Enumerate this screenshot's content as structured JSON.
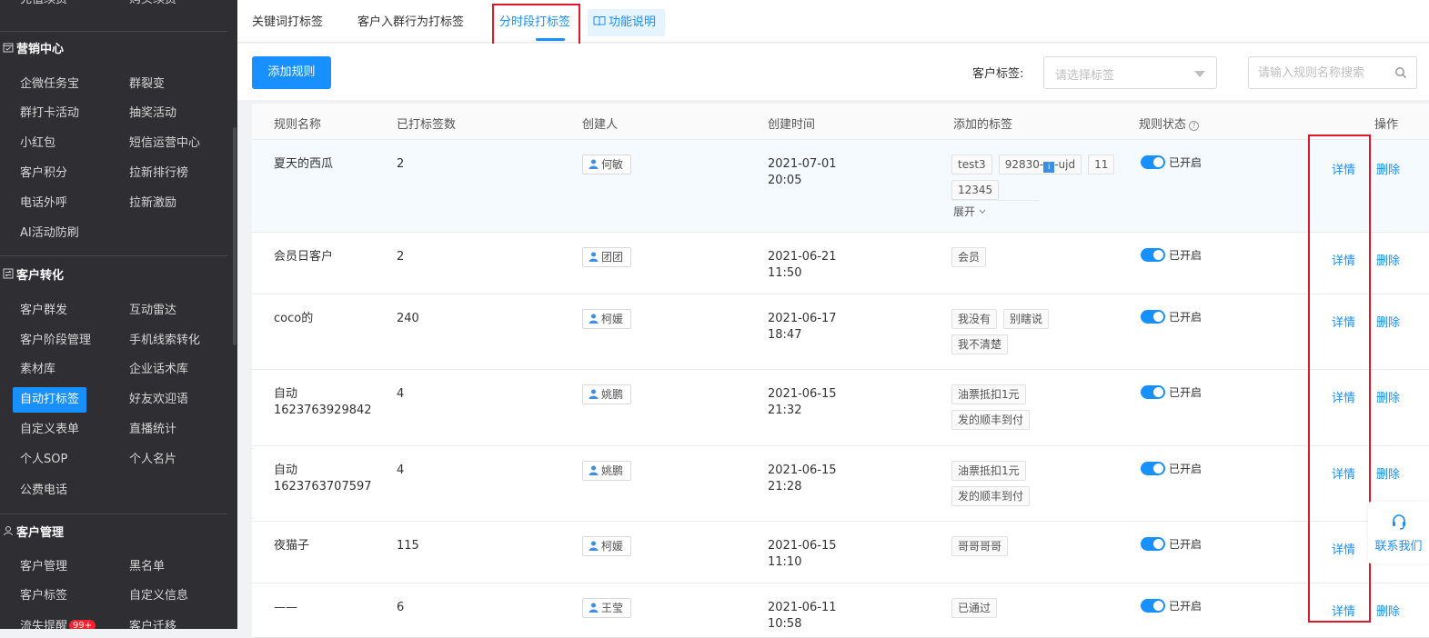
{
  "sidebar": {
    "top_cut_items": [
      "充值续费",
      "购买续费"
    ],
    "sections": [
      {
        "title": "营销中心",
        "icon": "calendar-check-icon",
        "items": [
          "企微任务宝",
          "群裂变",
          "群打卡活动",
          "抽奖活动",
          "小红包",
          "短信运营中心",
          "客户积分",
          "拉新排行榜",
          "电话外呼",
          "拉新激励",
          "AI活动防刷"
        ]
      },
      {
        "title": "客户转化",
        "icon": "swap-icon",
        "items": [
          "客户群发",
          "互动雷达",
          "客户阶段管理",
          "手机线索转化",
          "素材库",
          "企业话术库",
          "自动打标签",
          "好友欢迎语",
          "自定义表单",
          "直播统计",
          "个人SOP",
          "个人名片",
          "公费电话"
        ]
      },
      {
        "title": "客户管理",
        "icon": "user-icon",
        "items": [
          "客户管理",
          "黑名单",
          "客户标签",
          "自定义信息",
          "流失提醒",
          "客户迁移"
        ]
      }
    ],
    "active_item": "自动打标签",
    "loss_badge": "99+"
  },
  "tabs": {
    "keyword": "关键词打标签",
    "join_group": "客户入群行为打标签",
    "time_period": "分时段打标签",
    "help": "功能说明"
  },
  "toolbar": {
    "add_label": "添加规则",
    "filter_label": "客户标签:",
    "filter_placeholder": "请选择标签",
    "search_placeholder": "请输入规则名称搜索"
  },
  "table": {
    "headers": {
      "name": "规则名称",
      "count": "已打标签数",
      "creator": "创建人",
      "time": "创建时间",
      "tags": "添加的标签",
      "status": "规则状态",
      "ops": "操作"
    },
    "rows": [
      {
        "name": "夏天的西瓜",
        "count": "2",
        "creator": "何敏",
        "date": "2021-07-01",
        "clock": "20:05",
        "tags": [
          "test3",
          "92830-",
          "11",
          "12345"
        ],
        "expand": "展开",
        "status": "已开启"
      },
      {
        "name": "会员日客户",
        "count": "2",
        "creator": "团团",
        "date": "2021-06-21",
        "clock": "11:50",
        "tags": [
          "会员"
        ],
        "status": "已开启"
      },
      {
        "name": "coco的",
        "count": "240",
        "creator": "柯媛",
        "date": "2021-06-17",
        "clock": "18:47",
        "tags": [
          "我没有",
          "别瞎说",
          "我不清楚"
        ],
        "status": "已开启"
      },
      {
        "name": "自动",
        "name2": "1623763929842",
        "count": "4",
        "creator": "姚鹏",
        "date": "2021-06-15",
        "clock": "21:32",
        "tags": [
          "油票抵扣1元",
          "发的顺丰到付"
        ],
        "status": "已开启"
      },
      {
        "name": "自动",
        "name2": "1623763707597",
        "count": "4",
        "creator": "姚鹏",
        "date": "2021-06-15",
        "clock": "21:28",
        "tags": [
          "油票抵扣1元",
          "发的顺丰到付"
        ],
        "status": "已开启"
      },
      {
        "name": "夜猫子",
        "count": "115",
        "creator": "柯媛",
        "date": "2021-06-15",
        "clock": "11:10",
        "tags": [
          "哥哥哥哥"
        ],
        "status": "已开启"
      },
      {
        "name": "——",
        "count": "6",
        "creator": "王莹",
        "date": "2021-06-11",
        "clock": "10:58",
        "tags": [
          "已通过"
        ],
        "status": "已开启"
      }
    ],
    "tag_icon_glyph": "i",
    "tag_suffix": "-ujd",
    "detail": "详情",
    "delete": "删除"
  },
  "contact": {
    "label": "联系我们"
  },
  "colors": {
    "accent": "#1890ff",
    "sidebar_bg": "#2f2f33",
    "annotation_red": "#e0182a"
  }
}
